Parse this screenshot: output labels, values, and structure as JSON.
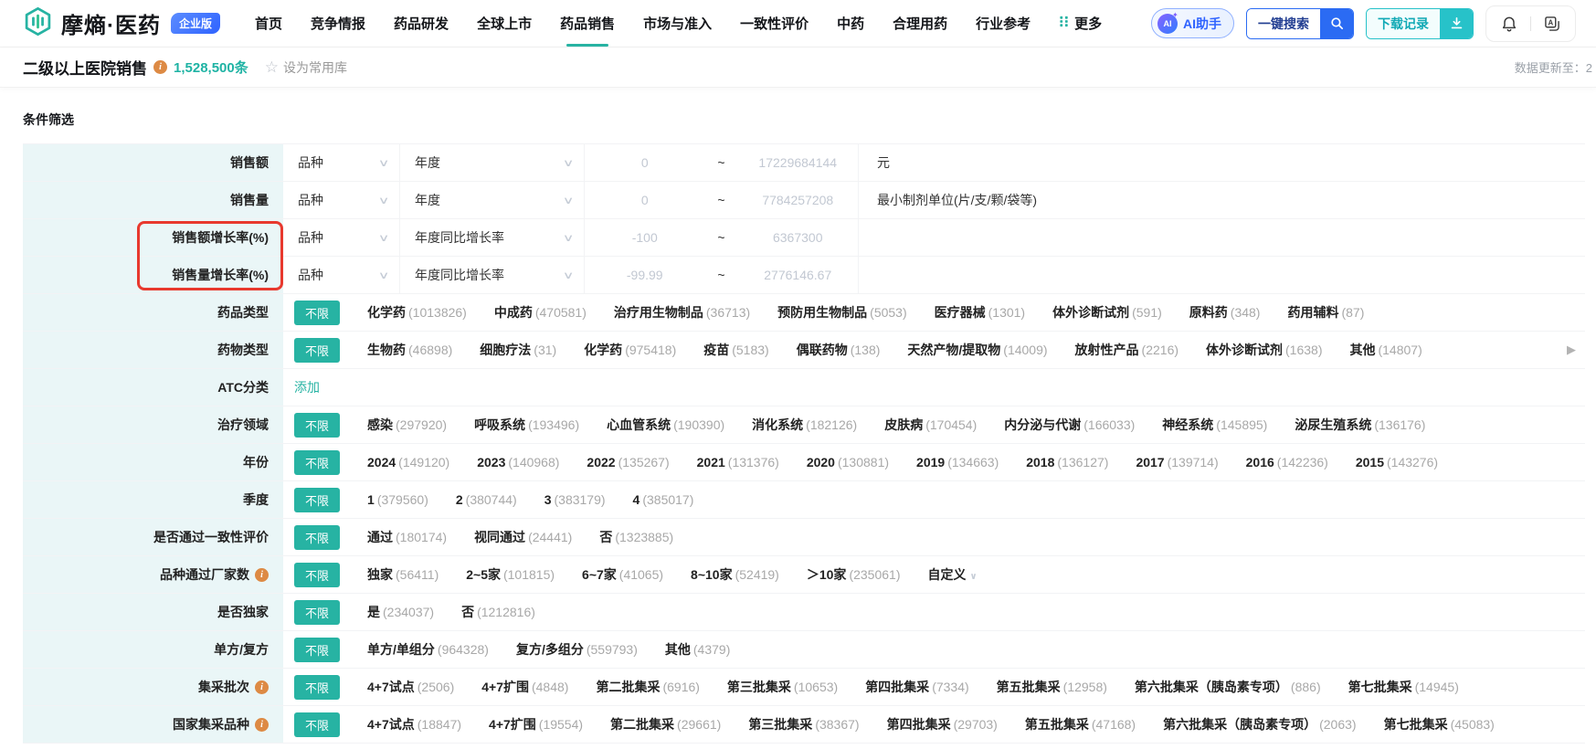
{
  "brand": {
    "name": "摩熵·医药",
    "badge": "企业版"
  },
  "navbar": {
    "items": [
      {
        "label": "首页",
        "active": false
      },
      {
        "label": "竞争情报",
        "active": false
      },
      {
        "label": "药品研发",
        "active": false
      },
      {
        "label": "全球上市",
        "active": false
      },
      {
        "label": "药品销售",
        "active": true
      },
      {
        "label": "市场与准入",
        "active": false
      },
      {
        "label": "一致性评价",
        "active": false
      },
      {
        "label": "中药",
        "active": false
      },
      {
        "label": "合理用药",
        "active": false
      },
      {
        "label": "行业参考",
        "active": false
      }
    ],
    "more_label": "更多",
    "ai_assistant": "AI助手",
    "quick_search": "一键搜索",
    "download_records": "下载记录"
  },
  "subheader": {
    "title": "二级以上医院销售",
    "record_count": "1,528,500条",
    "favorite_label": "设为常用库",
    "data_update": "数据更新至：2"
  },
  "filter_section": {
    "title": "条件筛选",
    "unlimited_label": "不限",
    "rows": [
      {
        "type": "range",
        "label": "销售额",
        "dim_select": "品种",
        "metric_select": "年度",
        "min_placeholder": "0",
        "max_placeholder": "17229684144",
        "separator": "~",
        "unit": "元",
        "highlight": false
      },
      {
        "type": "range",
        "label": "销售量",
        "dim_select": "品种",
        "metric_select": "年度",
        "min_placeholder": "0",
        "max_placeholder": "7784257208",
        "separator": "~",
        "unit": "最小制剂单位(片/支/颗/袋等)",
        "highlight": false
      },
      {
        "type": "range",
        "label": "销售额增长率(%)",
        "dim_select": "品种",
        "metric_select": "年度同比增长率",
        "min_placeholder": "-100",
        "max_placeholder": "6367300",
        "separator": "~",
        "unit": "",
        "highlight": true
      },
      {
        "type": "range",
        "label": "销售量增长率(%)",
        "dim_select": "品种",
        "metric_select": "年度同比增长率",
        "min_placeholder": "-99.99",
        "max_placeholder": "2776146.67",
        "separator": "~",
        "unit": "",
        "highlight": true
      },
      {
        "type": "options",
        "label": "药品类型",
        "info": false,
        "options": [
          {
            "name": "化学药",
            "count": "1013826"
          },
          {
            "name": "中成药",
            "count": "470581"
          },
          {
            "name": "治疗用生物制品",
            "count": "36713"
          },
          {
            "name": "预防用生物制品",
            "count": "5053"
          },
          {
            "name": "医疗器械",
            "count": "1301"
          },
          {
            "name": "体外诊断试剂",
            "count": "591"
          },
          {
            "name": "原料药",
            "count": "348"
          },
          {
            "name": "药用辅料",
            "count": "87"
          }
        ]
      },
      {
        "type": "options",
        "label": "药物类型",
        "info": false,
        "arrow_right": true,
        "options": [
          {
            "name": "生物药",
            "count": "46898"
          },
          {
            "name": "细胞疗法",
            "count": "31"
          },
          {
            "name": "化学药",
            "count": "975418"
          },
          {
            "name": "疫苗",
            "count": "5183"
          },
          {
            "name": "偶联药物",
            "count": "138"
          },
          {
            "name": "天然产物/提取物",
            "count": "14009"
          },
          {
            "name": "放射性产品",
            "count": "2216"
          },
          {
            "name": "体外诊断试剂",
            "count": "1638"
          },
          {
            "name": "其他",
            "count": "14807"
          }
        ]
      },
      {
        "type": "link",
        "label": "ATC分类",
        "link_label": "添加"
      },
      {
        "type": "options",
        "label": "治疗领域",
        "info": false,
        "options": [
          {
            "name": "感染",
            "count": "297920"
          },
          {
            "name": "呼吸系统",
            "count": "193496"
          },
          {
            "name": "心血管系统",
            "count": "190390"
          },
          {
            "name": "消化系统",
            "count": "182126"
          },
          {
            "name": "皮肤病",
            "count": "170454"
          },
          {
            "name": "内分泌与代谢",
            "count": "166033"
          },
          {
            "name": "神经系统",
            "count": "145895"
          },
          {
            "name": "泌尿生殖系统",
            "count": "136176"
          }
        ]
      },
      {
        "type": "options",
        "label": "年份",
        "info": false,
        "options": [
          {
            "name": "2024",
            "count": "149120"
          },
          {
            "name": "2023",
            "count": "140968"
          },
          {
            "name": "2022",
            "count": "135267"
          },
          {
            "name": "2021",
            "count": "131376"
          },
          {
            "name": "2020",
            "count": "130881"
          },
          {
            "name": "2019",
            "count": "134663"
          },
          {
            "name": "2018",
            "count": "136127"
          },
          {
            "name": "2017",
            "count": "139714"
          },
          {
            "name": "2016",
            "count": "142236"
          },
          {
            "name": "2015",
            "count": "143276"
          }
        ]
      },
      {
        "type": "options",
        "label": "季度",
        "info": false,
        "options": [
          {
            "name": "1",
            "count": "379560"
          },
          {
            "name": "2",
            "count": "380744"
          },
          {
            "name": "3",
            "count": "383179"
          },
          {
            "name": "4",
            "count": "385017"
          }
        ]
      },
      {
        "type": "options",
        "label": "是否通过一致性评价",
        "info": false,
        "options": [
          {
            "name": "通过",
            "count": "180174"
          },
          {
            "name": "视同通过",
            "count": "24441"
          },
          {
            "name": "否",
            "count": "1323885"
          }
        ]
      },
      {
        "type": "options",
        "label": "品种通过厂家数",
        "info": true,
        "options": [
          {
            "name": "独家",
            "count": "56411"
          },
          {
            "name": "2~5家",
            "count": "101815"
          },
          {
            "name": "6~7家",
            "count": "41065"
          },
          {
            "name": "8~10家",
            "count": "52419"
          },
          {
            "name": "＞10家",
            "count": "235061"
          },
          {
            "name": "自定义",
            "count": "",
            "chevron": true
          }
        ]
      },
      {
        "type": "options",
        "label": "是否独家",
        "info": false,
        "options": [
          {
            "name": "是",
            "count": "234037"
          },
          {
            "name": "否",
            "count": "1212816"
          }
        ]
      },
      {
        "type": "options",
        "label": "单方/复方",
        "info": false,
        "options": [
          {
            "name": "单方/单组分",
            "count": "964328"
          },
          {
            "name": "复方/多组分",
            "count": "559793"
          },
          {
            "name": "其他",
            "count": "4379"
          }
        ]
      },
      {
        "type": "options",
        "label": "集采批次",
        "info": true,
        "options": [
          {
            "name": "4+7试点",
            "count": "2506"
          },
          {
            "name": "4+7扩围",
            "count": "4848"
          },
          {
            "name": "第二批集采",
            "count": "6916"
          },
          {
            "name": "第三批集采",
            "count": "10653"
          },
          {
            "name": "第四批集采",
            "count": "7334"
          },
          {
            "name": "第五批集采",
            "count": "12958"
          },
          {
            "name": "第六批集采（胰岛素专项）",
            "count": "886"
          },
          {
            "name": "第七批集采",
            "count": "14945"
          }
        ]
      },
      {
        "type": "options",
        "label": "国家集采品种",
        "info": true,
        "options": [
          {
            "name": "4+7试点",
            "count": "18847"
          },
          {
            "name": "4+7扩围",
            "count": "19554"
          },
          {
            "name": "第二批集采",
            "count": "29661"
          },
          {
            "name": "第三批集采",
            "count": "38367"
          },
          {
            "name": "第四批集采",
            "count": "29703"
          },
          {
            "name": "第五批集采",
            "count": "47168"
          },
          {
            "name": "第六批集采（胰岛素专项）",
            "count": "2063"
          },
          {
            "name": "第七批集采",
            "count": "45083"
          }
        ]
      }
    ]
  },
  "icons": {
    "chevron_down": "∨",
    "arrow_right": "▶",
    "star": "☆",
    "sparkle": "✦"
  },
  "colors": {
    "accent_teal": "#27b3a3",
    "badge_blue": "#2f63ff",
    "search_blue": "#2b6bf3",
    "download_teal": "#27c2c9",
    "info_orange": "#dd8a44",
    "annotation_red": "#e8392e",
    "label_bg": "#eaf6f7",
    "placeholder_gray": "#c2c8d2"
  }
}
